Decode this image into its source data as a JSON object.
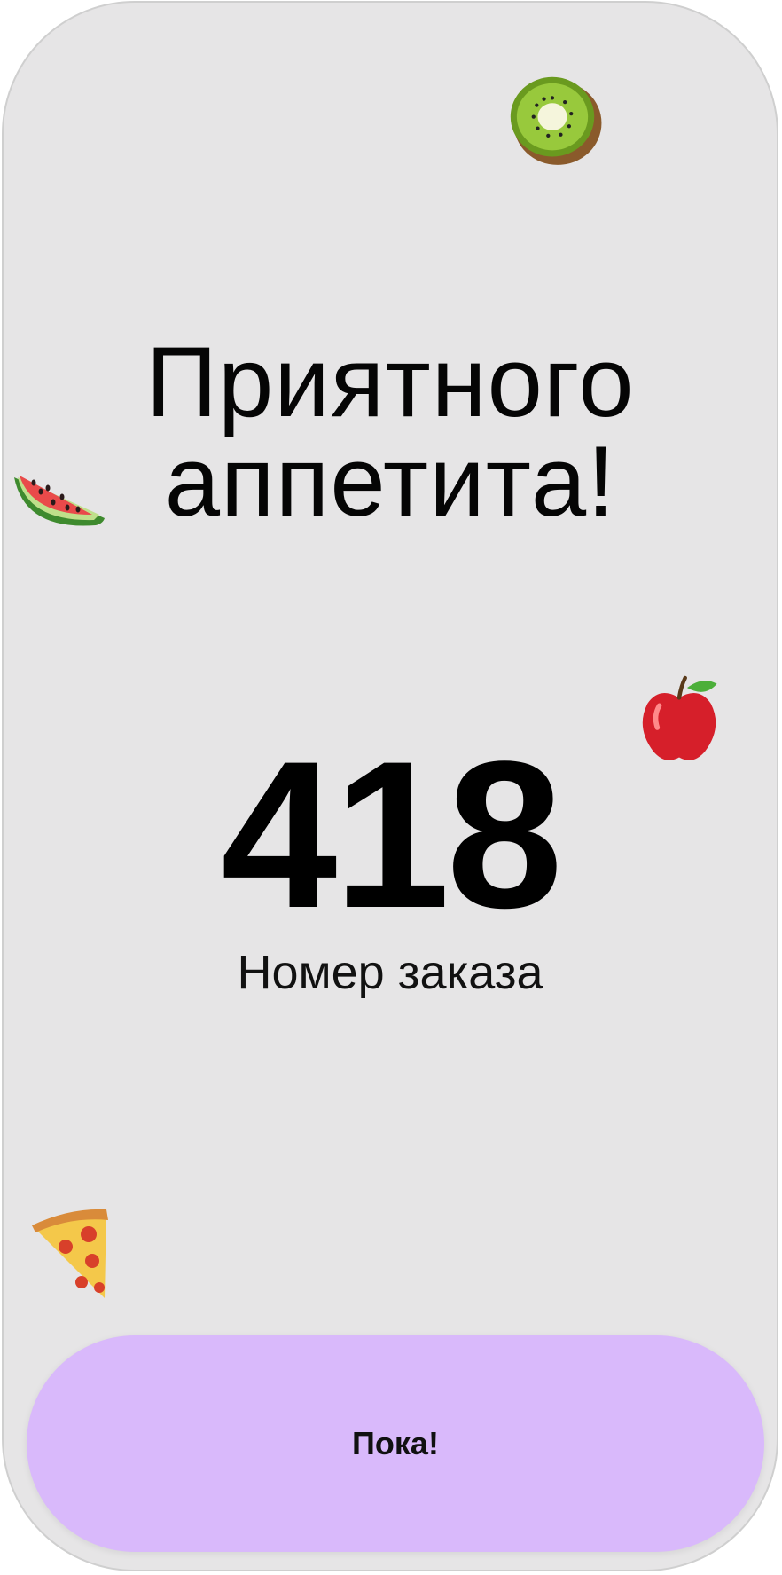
{
  "greeting": {
    "line1": "Приятного",
    "line2": "аппетита!"
  },
  "order": {
    "number": "418",
    "label": "Номер заказа"
  },
  "action": {
    "bye_label": "Пока!"
  },
  "decorations": [
    {
      "name": "kiwi-icon"
    },
    {
      "name": "watermelon-icon"
    },
    {
      "name": "apple-icon"
    },
    {
      "name": "pizza-icon"
    }
  ],
  "colors": {
    "background": "#e6e5e6",
    "button": "#d9b9fb",
    "text": "#000000"
  }
}
